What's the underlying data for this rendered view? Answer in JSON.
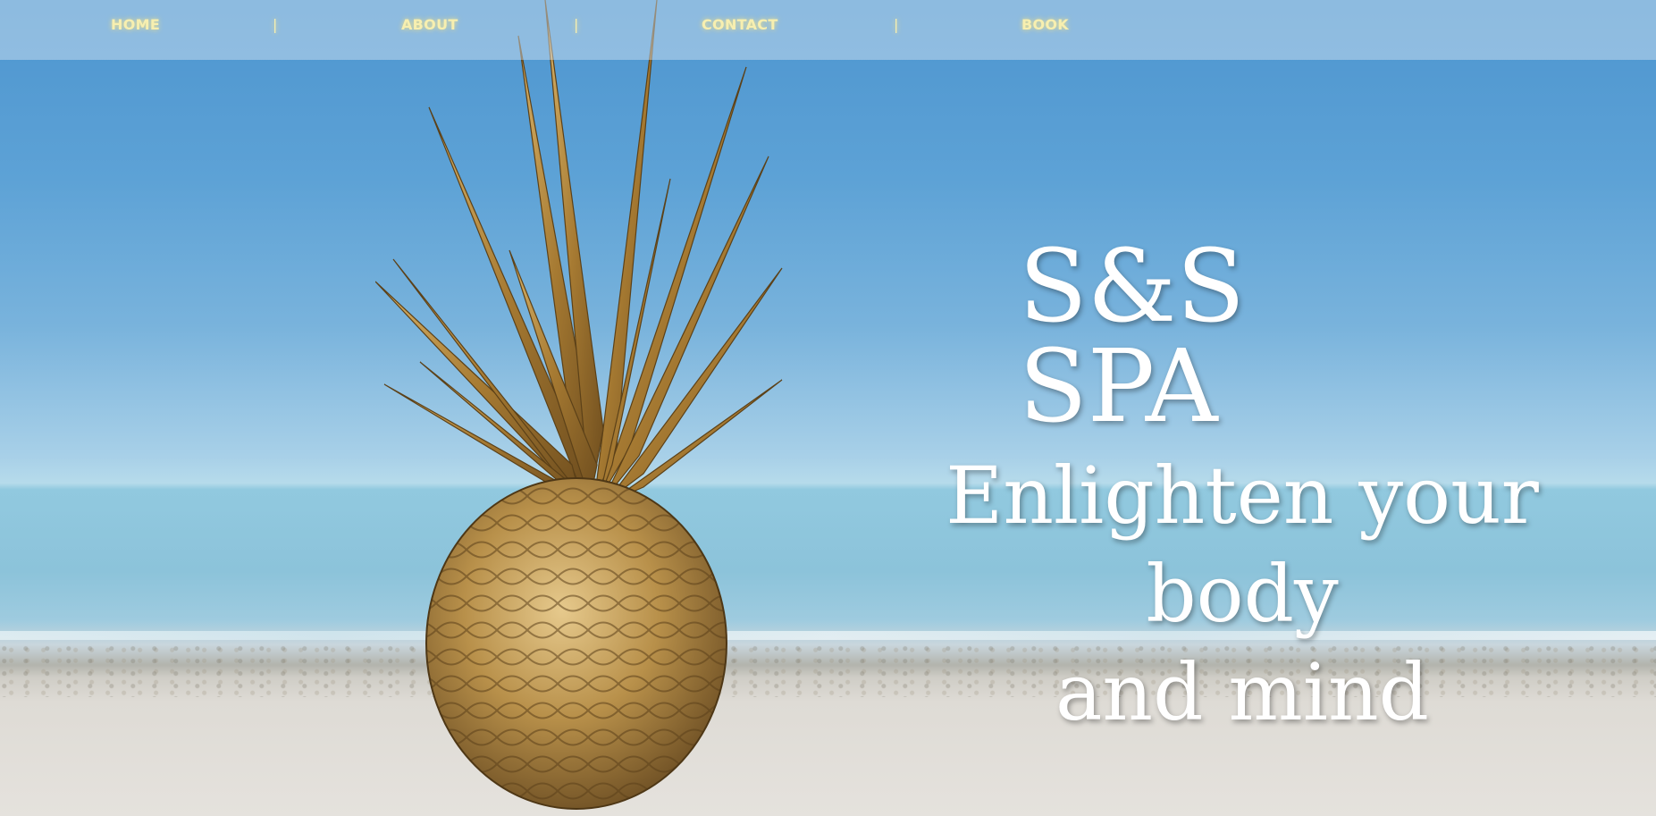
{
  "nav": {
    "items": [
      {
        "label": "HOME"
      },
      {
        "label": "ABOUT"
      },
      {
        "label": "CONTACT"
      },
      {
        "label": "BOOK"
      }
    ],
    "separator": "|"
  },
  "hero": {
    "title": "S&S SPA",
    "tagline_line1": "Enlighten your body",
    "tagline_line2": "and mind",
    "image": "golden-pineapple-on-beach"
  },
  "colors": {
    "nav_text": "#f7efb0",
    "headline_text": "#ffffff",
    "sky": "#4d95cf",
    "sea": "#8cc3da",
    "sand": "#e5e2dd",
    "pineapple_gold": "#b48a3c"
  }
}
